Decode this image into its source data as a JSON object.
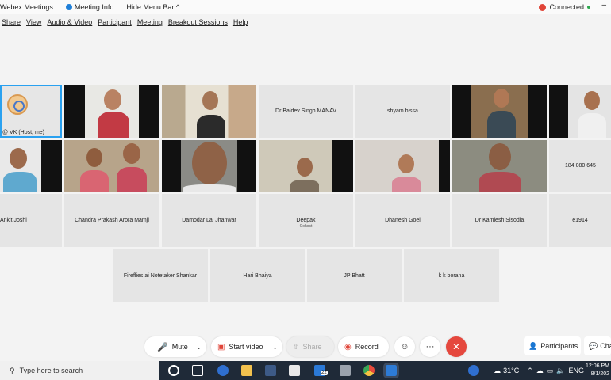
{
  "titlebar": {
    "app_name": "Webex Meetings",
    "meeting_info": "Meeting Info",
    "hide_menu": "Hide Menu Bar",
    "hide_menu_chevron": "^",
    "connected": "Connected",
    "minimize": "–"
  },
  "menu": [
    "Share",
    "View",
    "Audio & Video",
    "Participant",
    "Meeting",
    "Breakout Sessions",
    "Help"
  ],
  "tiles": {
    "self": {
      "label": "@ VK  (Host, me)"
    },
    "baldev": "Dr Baldev Singh MANAV",
    "shyam": "shyam bissa",
    "phone": "184 080 645",
    "ankit": "Ankit Joshi",
    "chandra": "Chandra Prakash Arora Mamji",
    "damodar": "Damodar Lal Jhanwar",
    "deepak": "Deepak",
    "deepak_sub": "Cohost",
    "dhanesh": "Dhanesh Goel",
    "kamlesh": "Dr Kamlesh Sisodia",
    "e1914": "e1914",
    "fireflies": "Fireflies.ai Notetaker Shankar",
    "hari": "Hari Bhaiya",
    "jp": "JP Bhatt",
    "kk": "k k borana"
  },
  "controls": {
    "mute": "Mute",
    "start_video": "Start video",
    "share": "Share",
    "record": "Record",
    "reactions_icon": "☺",
    "more": "···",
    "leave": "✕",
    "participants": "Participants",
    "chat": "Cha"
  },
  "taskbar": {
    "search_placeholder": "Type here to search",
    "weather": "31°C",
    "lang": "ENG",
    "time": "12:06 PM",
    "date": "8/1/202",
    "badge": "22"
  },
  "colors": {
    "accent": "#2aa1f0",
    "leave": "#e5483e",
    "record": "#e04438",
    "taskbar": "#1f2a38"
  }
}
